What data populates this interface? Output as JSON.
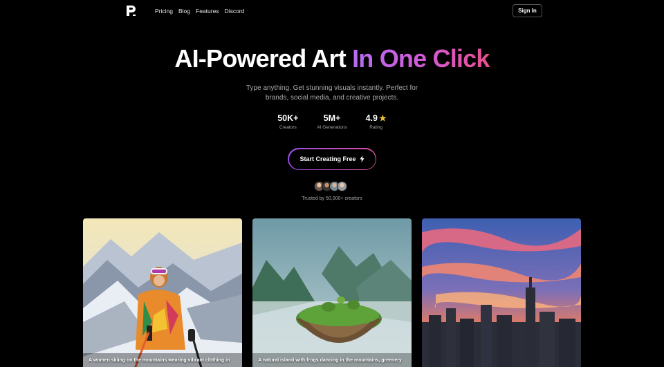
{
  "nav": {
    "links": [
      "Pricing",
      "Blog",
      "Features",
      "Discord"
    ],
    "signin_label": "Sign In"
  },
  "hero": {
    "title_plain": "AI-Powered Art",
    "title_gradient": "In One Click",
    "subtitle": "Type anything. Get stunning visuals instantly. Perfect for brands, social media, and creative projects."
  },
  "stats": [
    {
      "value": "50K+",
      "label": "Creators"
    },
    {
      "value": "5M+",
      "label": "AI Generations"
    },
    {
      "value": "4.9",
      "label": "Rating",
      "icon": "star-icon"
    }
  ],
  "cta": {
    "label": "Start Creating Free",
    "icon": "lightning-bolt-icon"
  },
  "social_proof": {
    "text": "Trusted by 50,000+ creators",
    "avatar_count": 4
  },
  "gallery": [
    {
      "caption": "A women skiing on the mountains wearing vibrant clothing in"
    },
    {
      "caption": "A natural island with frogs dancing in the mountains, greenery"
    },
    {
      "caption": ""
    }
  ],
  "colors": {
    "background": "#000000",
    "gradient_start": "#b46cf0",
    "gradient_end": "#e8508a",
    "star": "#f3c13a"
  }
}
